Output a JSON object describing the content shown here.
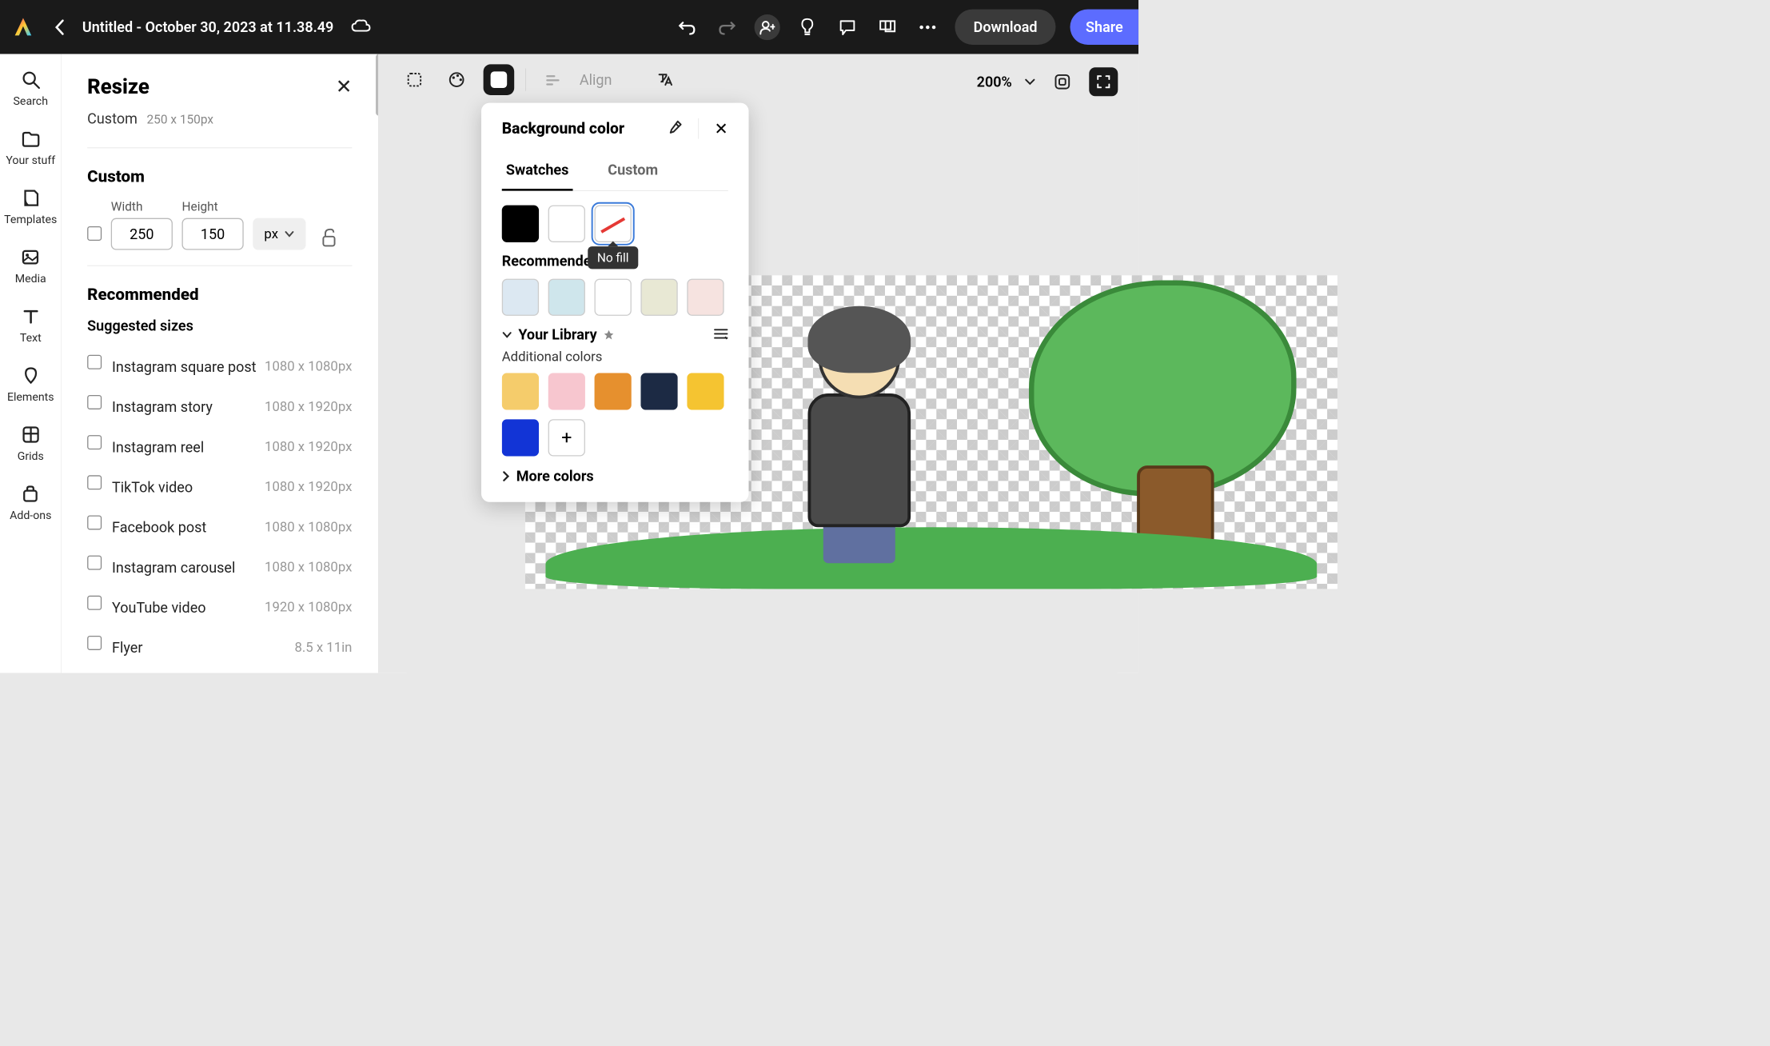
{
  "header": {
    "title": "Untitled - October 30, 2023 at 11.38.49",
    "download": "Download",
    "share": "Share"
  },
  "rail": {
    "search": "Search",
    "your_stuff": "Your stuff",
    "templates": "Templates",
    "media": "Media",
    "text": "Text",
    "elements": "Elements",
    "grids": "Grids",
    "addons": "Add-ons"
  },
  "resize": {
    "title": "Resize",
    "custom_label": "Custom",
    "custom_dims": "250 x 150px",
    "custom_section": "Custom",
    "width_label": "Width",
    "height_label": "Height",
    "width_value": "250",
    "height_value": "150",
    "unit": "px",
    "recommended_section": "Recommended",
    "suggested_label": "Suggested sizes",
    "sizes": [
      {
        "name": "Instagram square post",
        "dim": "1080 x 1080px"
      },
      {
        "name": "Instagram story",
        "dim": "1080 x 1920px"
      },
      {
        "name": "Instagram reel",
        "dim": "1080 x 1920px"
      },
      {
        "name": "TikTok video",
        "dim": "1080 x 1920px"
      },
      {
        "name": "Facebook post",
        "dim": "1080 x 1080px"
      },
      {
        "name": "Instagram carousel",
        "dim": "1080 x 1080px"
      },
      {
        "name": "YouTube video",
        "dim": "1920 x 1080px"
      },
      {
        "name": "Flyer",
        "dim": "8.5 x 11in"
      }
    ]
  },
  "toolbar": {
    "align": "Align",
    "zoom": "200%"
  },
  "popover": {
    "title": "Background color",
    "tab_swatches": "Swatches",
    "tab_custom": "Custom",
    "basic_swatches": [
      {
        "color": "#000000",
        "border": "#000000"
      },
      {
        "color": "#ffffff",
        "border": "#cccccc"
      }
    ],
    "nofill_tooltip": "No fill",
    "recommended_label": "Recommended",
    "recommended_swatches": [
      "#dce8f2",
      "#cfe6ec",
      "#ffffff",
      "#e8e8d4",
      "#f6e3e0"
    ],
    "library_label": "Your Library",
    "additional_label": "Additional colors",
    "library_swatches": [
      "#f5cc6b",
      "#f7c6cf",
      "#e6902e",
      "#1c2a44",
      "#f5c431",
      "#1234d6"
    ],
    "more_label": "More colors"
  }
}
